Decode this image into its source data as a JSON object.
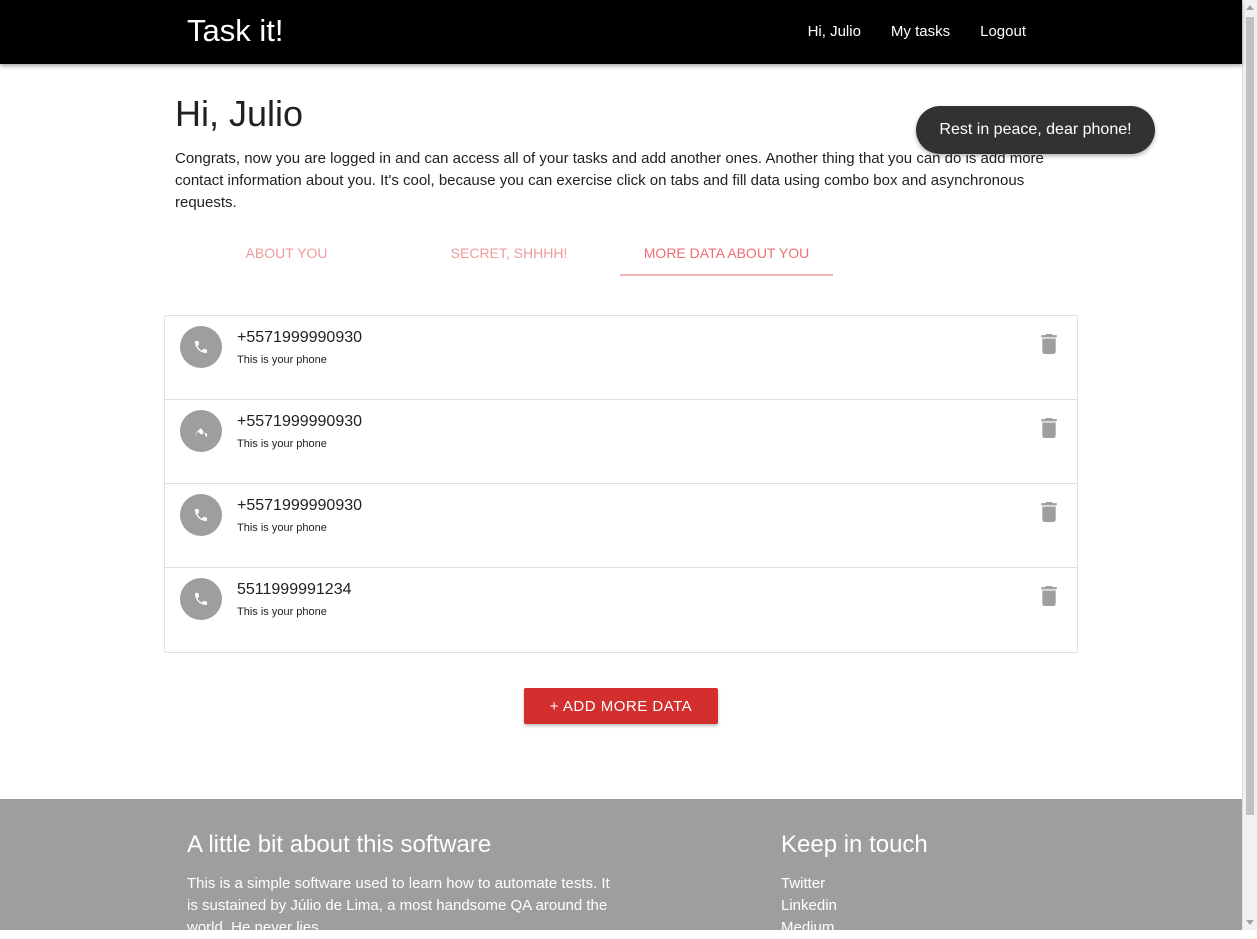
{
  "navbar": {
    "brand": "Task it!",
    "links": [
      "Hi, Julio",
      "My tasks",
      "Logout"
    ]
  },
  "main": {
    "title": "Hi, Julio",
    "intro": "Congrats, now you are logged in and can access all of your tasks and add another ones. Another thing that you can do is add more contact information about you. It's cool, because you can exercise click on tabs and fill data using combo box and asynchronous requests.",
    "tabs": [
      {
        "label": "About you",
        "active": false
      },
      {
        "label": "Secret, shhhh!",
        "active": false
      },
      {
        "label": "More data about you",
        "active": true
      }
    ],
    "items": [
      {
        "title": "+5571999990930",
        "subtitle": "This is your phone",
        "icon": "phone-icon"
      },
      {
        "title": "+5571999990930",
        "subtitle": "This is your phone",
        "icon": "phone-icon"
      },
      {
        "title": "+5571999990930",
        "subtitle": "This is your phone",
        "icon": "phone-icon"
      },
      {
        "title": "5511999991234",
        "subtitle": "This is your phone",
        "icon": "phone-icon"
      }
    ],
    "add_button": "+ Add more data"
  },
  "toast": {
    "message": "Rest in peace, dear phone!"
  },
  "footer": {
    "about_title": "A little bit about this software",
    "about_text": "This is a simple software used to learn how to automate tests. It is sustained by Júlio de Lima, a most handsome QA around the world. He never lies.",
    "contact_title": "Keep in touch",
    "contact_links": [
      "Twitter",
      "Linkedin",
      "Medium"
    ]
  },
  "colors": {
    "navbar": "#000000",
    "tab_inactive": "#ef9a9a",
    "tab_active": "#ee6e73",
    "add_button": "#d32f2f",
    "footer": "#9e9e9e",
    "toast": "#323232"
  }
}
